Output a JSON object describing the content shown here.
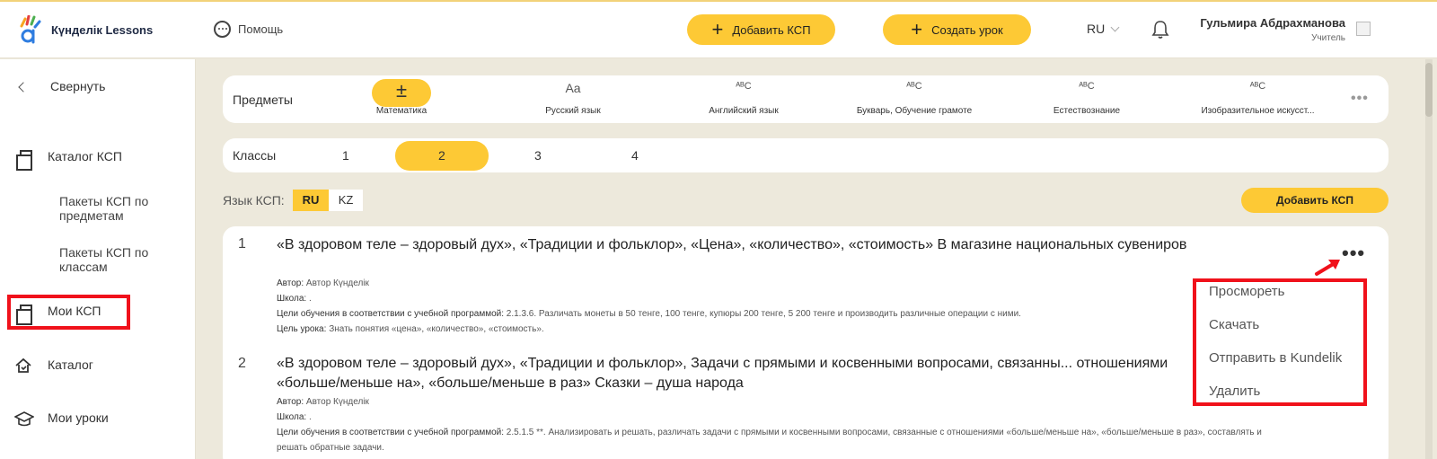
{
  "app": {
    "logo_text": "Күнделік Lessons"
  },
  "header": {
    "help": "Помощь",
    "add_ksp": "Добавить КСП",
    "create_lesson": "Создать урок",
    "lang": "RU",
    "user_name": "Гульмира Абдрахманова",
    "user_role": "Учитель"
  },
  "sidebar": {
    "collapse": "Свернуть",
    "catalog_ksp": "Каталог КСП",
    "packages_by_subject": "Пакеты КСП по предметам",
    "packages_by_class": "Пакеты КСП по классам",
    "my_ksp": "Мои КСП",
    "catalog": "Каталог",
    "my_lessons": "Мои уроки"
  },
  "subjects": {
    "label": "Предметы",
    "items": [
      {
        "icon": "±",
        "name": "Математика"
      },
      {
        "icon": "Aa",
        "name": "Русский язык"
      },
      {
        "icon": "ᴬᴮC",
        "name": "Английский язык"
      },
      {
        "icon": "ᴬᴮC",
        "name": "Букварь, Обучение грамоте"
      },
      {
        "icon": "ᴬᴮC",
        "name": "Естествознание"
      },
      {
        "icon": "ᴬᴮC",
        "name": "Изобразительное искусст..."
      }
    ],
    "more": "•••"
  },
  "classes": {
    "label": "Классы",
    "items": [
      "1",
      "2",
      "3",
      "4"
    ],
    "selected": "2"
  },
  "ksp_lang": {
    "label": "Язык КСП:",
    "ru": "RU",
    "kz": "KZ"
  },
  "add_ksp_button": "Добавить КСП",
  "list": [
    {
      "num": "1",
      "title": "«В здоровом теле – здоровый дух», «Традиции и фольклор», «Цена», «количество», «стоимость» В магазине национальных сувениров",
      "author_label": "Автор:",
      "author": "Автор Күнделік",
      "school_label": "Школа:",
      "school": ".",
      "goals_label": "Цели обучения в соответствии с учебной программой:",
      "goals": "2.1.3.6. Различать монеты в 50 тенге, 100 тенге, купюры 200 тенге, 5 200 тенге и производить различные операции с ними.",
      "aim_label": "Цель урока:",
      "aim": "Знать понятия «цена», «количество», «стоимость»."
    },
    {
      "num": "2",
      "title": "«В здоровом теле – здоровый дух», «Традиции и фольклор», Задачи с прямыми и косвенными вопросами, связанны... отношениями «больше/меньше на», «больше/меньше в раз» Сказки – душа народа",
      "author_label": "Автор:",
      "author": "Автор Күнделік",
      "school_label": "Школа:",
      "school": ".",
      "goals_label": "Цели обучения в соответствии с учебной программой:",
      "goals": "2.5.1.5 **. Анализировать и решать, различать задачи с прямыми и косвенными вопросами, связанные с отношениями «больше/меньше на», «больше/меньше в раз», составлять и решать обратные задачи."
    }
  ],
  "context_menu": {
    "view": "Просмореть",
    "download": "Скачать",
    "send": "Отправить в Kundelik",
    "delete": "Удалить"
  },
  "colors": {
    "accent": "#fdc935",
    "highlight": "#f0111b",
    "background": "#ede9dc"
  }
}
